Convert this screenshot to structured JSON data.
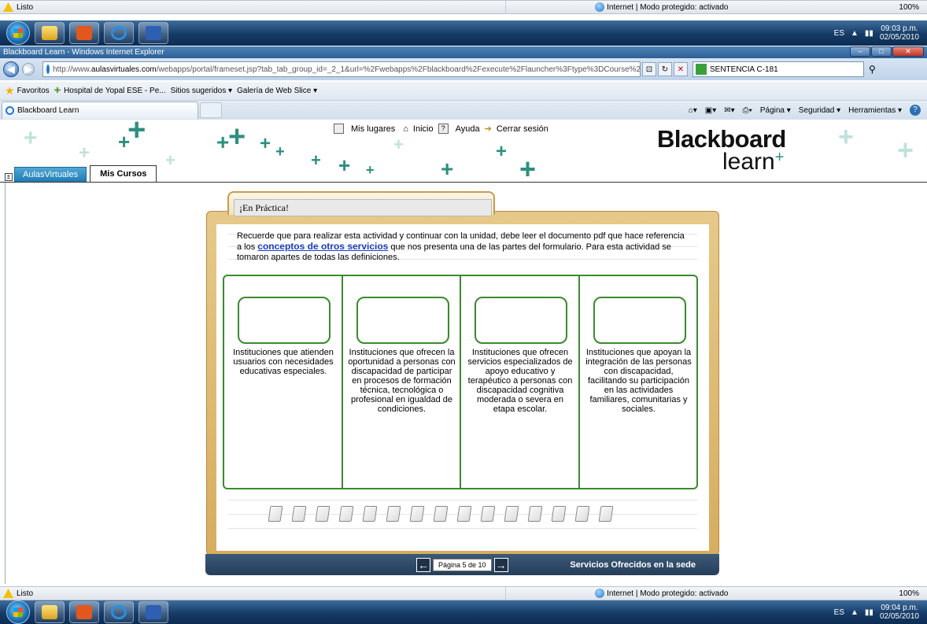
{
  "top_status": {
    "text": "Listo",
    "zone": "Internet | Modo protegido: activado",
    "zoom": "100%"
  },
  "top_taskbar": {
    "lang": "ES",
    "time": "09:03 p.m.",
    "date": "02/05/2010"
  },
  "window": {
    "title": "Blackboard Learn - Windows Internet Explorer"
  },
  "address": {
    "prefix": "http://www.",
    "domain": "aulasvirtuales.com",
    "path": "/webapps/portal/frameset.jsp?tab_tab_group_id=_2_1&url=%2Fwebapps%2Fblackboard%2Fexecute%2Flauncher%3Ftype%3DCourse%26id%3D_1:",
    "search_text": "SENTENCIA C-181"
  },
  "favorites": {
    "label": "Favoritos",
    "items": [
      "Hospital de Yopal ESE - Pe...",
      "Sitios sugeridos ▾",
      "Galería de Web Slice ▾"
    ]
  },
  "tab": {
    "label": "Blackboard Learn"
  },
  "commands": [
    "Página ▾",
    "Seguridad ▾",
    "Herramientas ▾"
  ],
  "bb": {
    "links": [
      "Mis lugares",
      "Inicio",
      "Ayuda",
      "Cerrar sesión"
    ],
    "logo_top": "Blackboard",
    "logo_bottom": "learn",
    "tabs": [
      "AulasVirtuales",
      "Mis Cursos"
    ]
  },
  "activity": {
    "folder_title": "¡En Práctica!",
    "intro_before": "Recuerde que para realizar esta actividad y continuar con la unidad, debe leer el documento pdf que hace referencia a los ",
    "intro_link": "conceptos de otros servicios",
    "intro_after": " que nos presenta una de las partes del formulario. Para esta actividad se tomaron apartes de todas las definiciones.",
    "columns": [
      "Instituciones que atienden usuarios con necesidades educativas especiales.",
      "Instituciones que ofrecen la oportunidad a personas con discapacidad de participar en procesos de formación técnica, tecnológica o profesional en igualdad de condiciones.",
      "Instituciones que ofrecen servicios especializados de apoyo educativo y terapéutico a personas con discapacidad cognitiva moderada o severa en etapa escolar.",
      "Instituciones que apoyan la integración de las personas con discapacidad, facilitando su participación en las actividades familiares, comunitarias y sociales."
    ],
    "card_count": 15,
    "page_indicator": "Página 5 de 10",
    "section_name": "Servicios Ofrecidos en la sede"
  },
  "bottom_status": {
    "text": "Listo",
    "zone": "Internet | Modo protegido: activado",
    "zoom": "100%"
  },
  "bottom_taskbar": {
    "lang": "ES",
    "time": "09:04 p.m.",
    "date": "02/05/2010"
  }
}
